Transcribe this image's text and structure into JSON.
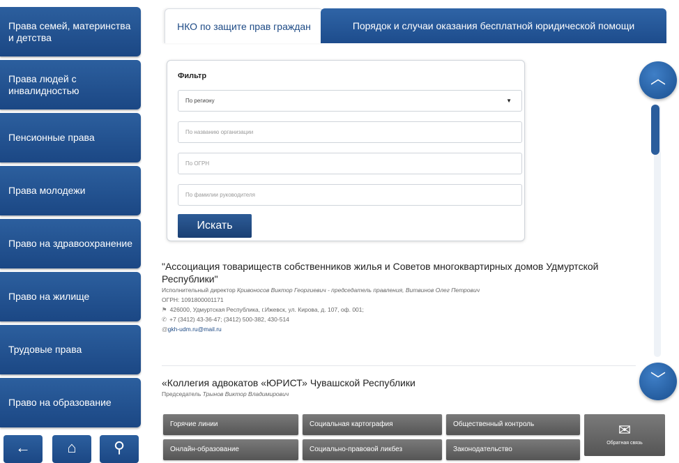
{
  "sidebar": {
    "items": [
      {
        "label": "Права семей, материнства и детства"
      },
      {
        "label": "Права людей с инвалидностью"
      },
      {
        "label": "Пенсионные права"
      },
      {
        "label": "Права молодежи"
      },
      {
        "label": "Право на здравоохранение"
      },
      {
        "label": "Право на жилище"
      },
      {
        "label": "Трудовые права"
      },
      {
        "label": "Право на образование"
      }
    ],
    "nav": {
      "back_icon": "←",
      "home_icon": "⌂",
      "search_icon": "⚲"
    }
  },
  "tabs": [
    {
      "label": "НКО по защите прав граждан"
    },
    {
      "label": "Порядок и случаи оказания бесплатной юридической помощи"
    }
  ],
  "filter": {
    "title": "Фильтр",
    "region_select": "По региону",
    "org_name_placeholder": "По названию организации",
    "ogrn_placeholder": "По ОГРН",
    "head_placeholder": "По фамилии руководителя",
    "search_button": "Искать"
  },
  "orgs": [
    {
      "name": "\"Ассоциация товариществ собственников жилья и Советов многоквартирных домов Удмуртской Республики\"",
      "director_prefix": "Исполнительный директор ",
      "director": "Кривоносов Виктор Георгиевич - председатель правления, Витвинов Олег Петрович",
      "ogrn": "ОГРН: 1091800001171",
      "address": "426000, Удмуртская Республика, г.Ижевск, ул. Кирова, д. 107, оф. 001;",
      "phone": "+7 (3412) 43-36-47; (3412) 500-382, 430-514",
      "email": "gkh-udm.ru@mail.ru"
    },
    {
      "name": "«Коллегия адвокатов «ЮРИСТ» Чувашской Республики",
      "director_prefix": "Председатель ",
      "director": "Трынов Виктор Владимирович"
    }
  ],
  "bottom": {
    "row1": [
      "Горячие линии",
      "Социальная картография",
      "Общественный контроль"
    ],
    "row2": [
      "Онлайн-образование",
      "Социально-правовой ликбез",
      "Законодательство"
    ],
    "feedback": "Обратная связь"
  },
  "colors": {
    "primary": "#1d4a85",
    "gray_button": "#666666"
  }
}
